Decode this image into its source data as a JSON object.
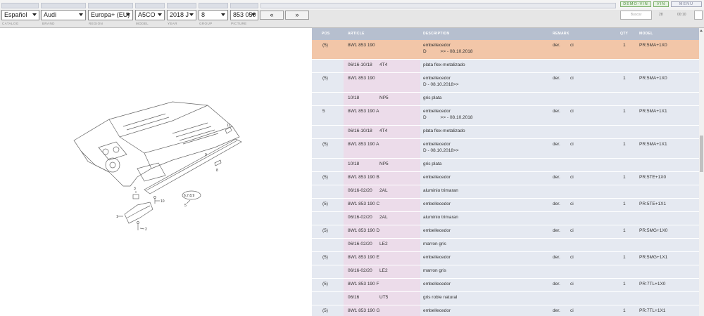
{
  "toolbar": {
    "selects": {
      "language": "Español",
      "brand": "Audi",
      "region": "Europa+ (EU)",
      "model": "A5CO",
      "year": "2018 J",
      "group": "8",
      "picture": "853 050"
    },
    "prev_label": "«",
    "next_label": "»",
    "sublabels": {
      "catalog": "CATALOG",
      "brand": "BRAND",
      "region": "REGION",
      "model": "MODEL",
      "year": "YEAR",
      "group": "GROUP",
      "picture": "PICTURE"
    },
    "demo_vin_label": "DEMO-VIN",
    "vin_label": "VIN",
    "menu_label": "MENU",
    "search_placeholder": "Buscar",
    "num_a": "28",
    "num_b": "00:10"
  },
  "table": {
    "headers": {
      "pos": "POS",
      "article": "ARTICLE",
      "description": "DESCRIPTION",
      "remark": "REMARK",
      "qty": "QTY",
      "model": "MODEL"
    },
    "rows": [
      {
        "pos": "(5)",
        "article": "8W1 853 190",
        "code": "",
        "desc1": "embellecedor",
        "desc2": "D           >> - 08.10.2018",
        "rem_a": "der.",
        "rem_b": "ci",
        "qty": "1",
        "model": "PR:5MA+1X0",
        "highlight": true
      },
      {
        "pos": "",
        "article": "06/16-10/18",
        "code": "4T4",
        "desc1": "plata flex-metalizado",
        "desc2": "",
        "rem_a": "",
        "rem_b": "",
        "qty": "",
        "model": ""
      },
      {
        "pos": "(5)",
        "article": "8W1 853 190",
        "code": "",
        "desc1": "embellecedor",
        "desc2": "D - 08.10.2018>>",
        "rem_a": "der.",
        "rem_b": "ci",
        "qty": "1",
        "model": "PR:5MA+1X0"
      },
      {
        "pos": "",
        "article": "10/18",
        "code": "NP5",
        "desc1": "gris plata",
        "desc2": "",
        "rem_a": "",
        "rem_b": "",
        "qty": "",
        "model": ""
      },
      {
        "pos": "5",
        "article": "8W1 853 190 A",
        "code": "",
        "desc1": "embellecedor",
        "desc2": "D           >> - 08.10.2018",
        "rem_a": "der.",
        "rem_b": "ci",
        "qty": "1",
        "model": "PR:5MA+1X1"
      },
      {
        "pos": "",
        "article": "06/16-10/18",
        "code": "4T4",
        "desc1": "plata flex-metalizado",
        "desc2": "",
        "rem_a": "",
        "rem_b": "",
        "qty": "",
        "model": ""
      },
      {
        "pos": "(5)",
        "article": "8W1 853 190 A",
        "code": "",
        "desc1": "embellecedor",
        "desc2": "D - 08.10.2018>>",
        "rem_a": "der.",
        "rem_b": "ci",
        "qty": "1",
        "model": "PR:5MA+1X1"
      },
      {
        "pos": "",
        "article": "10/18",
        "code": "NP5",
        "desc1": "gris plata",
        "desc2": "",
        "rem_a": "",
        "rem_b": "",
        "qty": "",
        "model": ""
      },
      {
        "pos": "(5)",
        "article": "8W1 853 190 B",
        "code": "",
        "desc1": "embellecedor",
        "desc2": "",
        "rem_a": "der.",
        "rem_b": "ci",
        "qty": "1",
        "model": "PR:5TE+1X0"
      },
      {
        "pos": "",
        "article": "06/16-02/20",
        "code": "2AL",
        "desc1": "aluminio trimaran",
        "desc2": "",
        "rem_a": "",
        "rem_b": "",
        "qty": "",
        "model": ""
      },
      {
        "pos": "(5)",
        "article": "8W1 853 190 C",
        "code": "",
        "desc1": "embellecedor",
        "desc2": "",
        "rem_a": "der.",
        "rem_b": "ci",
        "qty": "1",
        "model": "PR:5TE+1X1"
      },
      {
        "pos": "",
        "article": "06/16-02/20",
        "code": "2AL",
        "desc1": "aluminio trimaran",
        "desc2": "",
        "rem_a": "",
        "rem_b": "",
        "qty": "",
        "model": ""
      },
      {
        "pos": "(5)",
        "article": "8W1 853 190 D",
        "code": "",
        "desc1": "embellecedor",
        "desc2": "",
        "rem_a": "der.",
        "rem_b": "ci",
        "qty": "1",
        "model": "PR:5MG+1X0"
      },
      {
        "pos": "",
        "article": "06/16-02/20",
        "code": "LE2",
        "desc1": "marron gris",
        "desc2": "",
        "rem_a": "",
        "rem_b": "",
        "qty": "",
        "model": ""
      },
      {
        "pos": "(5)",
        "article": "8W1 853 190 E",
        "code": "",
        "desc1": "embellecedor",
        "desc2": "",
        "rem_a": "der.",
        "rem_b": "ci",
        "qty": "1",
        "model": "PR:5MG+1X1"
      },
      {
        "pos": "",
        "article": "06/16-02/20",
        "code": "LE2",
        "desc1": "marron gris",
        "desc2": "",
        "rem_a": "",
        "rem_b": "",
        "qty": "",
        "model": ""
      },
      {
        "pos": "(5)",
        "article": "8W1 853 190 F",
        "code": "",
        "desc1": "embellecedor",
        "desc2": "",
        "rem_a": "der.",
        "rem_b": "ci",
        "qty": "1",
        "model": "PR:7TL+1X0"
      },
      {
        "pos": "",
        "article": "06/16",
        "code": "UT5",
        "desc1": "gris roble natural",
        "desc2": "",
        "rem_a": "",
        "rem_b": "",
        "qty": "",
        "model": ""
      },
      {
        "pos": "(5)",
        "article": "8W1 853 190 G",
        "code": "",
        "desc1": "embellecedor",
        "desc2": "",
        "rem_a": "der.",
        "rem_b": "ci",
        "qty": "1",
        "model": "PR:7TL+1X1"
      }
    ]
  },
  "drawing": {
    "callouts": [
      "11",
      "9",
      "8",
      "3",
      "10",
      "6,7,8,9",
      "5",
      "1",
      "2"
    ]
  },
  "colors": {
    "highlight_row": "#f2c6a8",
    "row_bg": "#e5e9f1",
    "article_bg": "#ecdcea",
    "header_bg": "#b6bfcf"
  }
}
